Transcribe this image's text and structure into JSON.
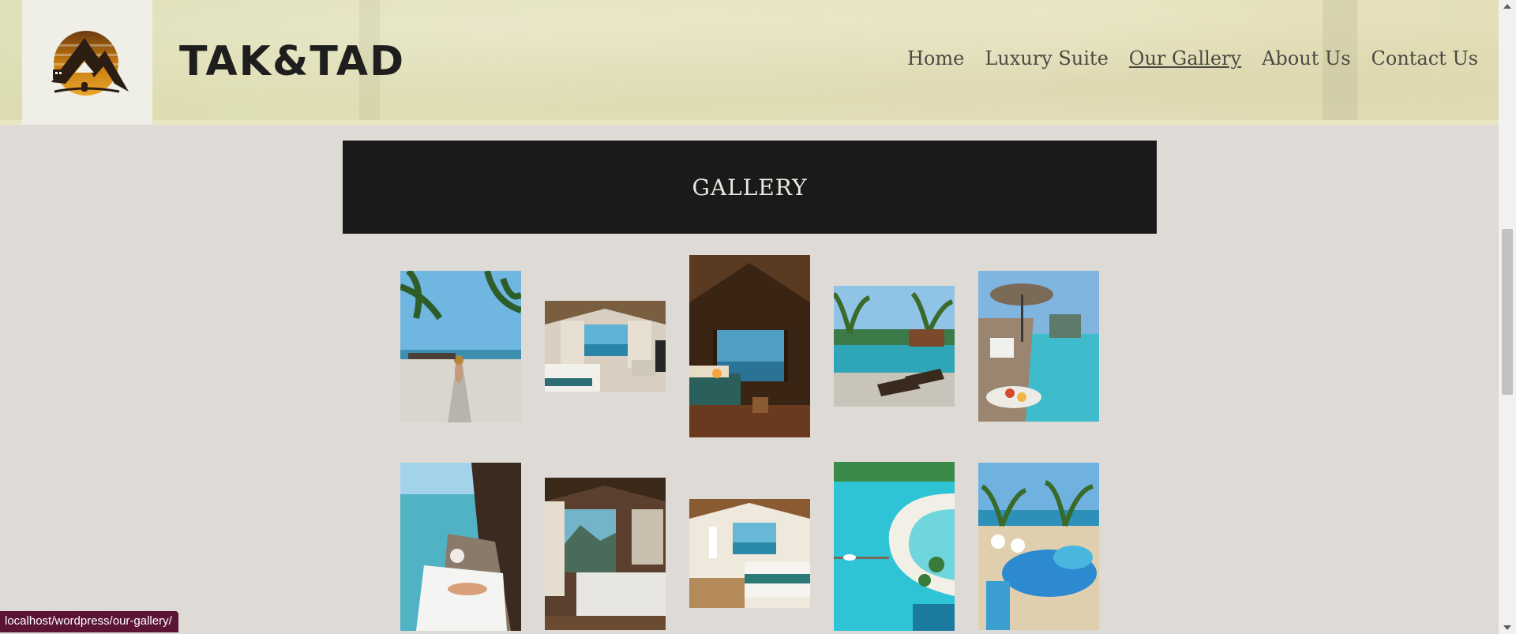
{
  "site": {
    "brand": "TAK&TAD",
    "logo_icon": "mountain-house-logo"
  },
  "nav": {
    "items": [
      {
        "label": "Home"
      },
      {
        "label": "Luxury Suite"
      },
      {
        "label": "Our Gallery",
        "active": true
      },
      {
        "label": "About Us"
      },
      {
        "label": "Contact Us"
      }
    ]
  },
  "gallery": {
    "title": "GALLERY",
    "images": [
      {
        "name": "beach-walk-photo"
      },
      {
        "name": "bedroom-ocean-view-photo"
      },
      {
        "name": "wooden-villa-interior-photo"
      },
      {
        "name": "infinity-pool-loungers-photo"
      },
      {
        "name": "poolside-breakfast-photo"
      },
      {
        "name": "overwater-deck-relax-photo"
      },
      {
        "name": "rustic-bedroom-view-photo"
      },
      {
        "name": "tropical-suite-photo"
      },
      {
        "name": "aerial-lagoon-photo"
      },
      {
        "name": "resort-pool-aerial-photo"
      }
    ]
  },
  "status_bar": {
    "url": "localhost/wordpress/our-gallery/"
  },
  "colors": {
    "banner_bg": "#1a1a1a",
    "page_bg": "#dedbd6",
    "status_bg": "#5c1436"
  }
}
